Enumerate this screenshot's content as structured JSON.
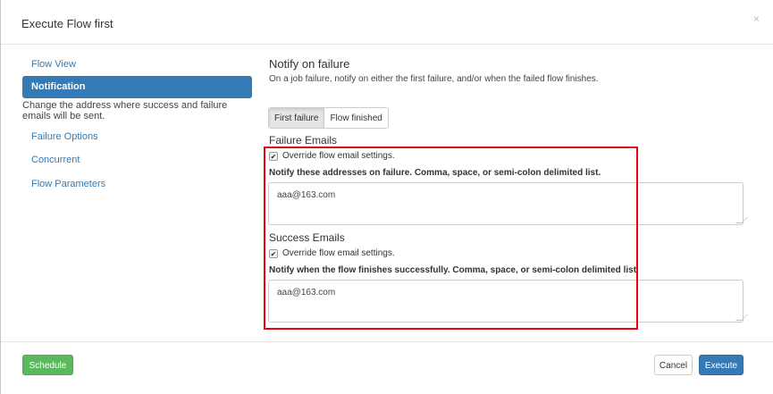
{
  "modal": {
    "title": "Execute Flow first",
    "close_glyph": "×"
  },
  "sidebar": {
    "items": [
      {
        "label": "Flow View"
      },
      {
        "label": "Notification"
      },
      {
        "label": "Failure Options"
      },
      {
        "label": "Concurrent"
      },
      {
        "label": "Flow Parameters"
      }
    ],
    "help_text": "Change the address where success and failure emails will be sent."
  },
  "main": {
    "title": "Notify on failure",
    "description": "On a job failure, notify on either the first failure, and/or when the failed flow finishes.",
    "toggle": {
      "first_failure": "First failure",
      "flow_finished": "Flow finished",
      "selected": "First failure"
    },
    "failure_emails": {
      "title": "Failure Emails",
      "override_label": "Override flow email settings.",
      "override_checked": true,
      "help": "Notify these addresses on failure. Comma, space, or semi-colon delimited list.",
      "value": "aaa@163.com"
    },
    "success_emails": {
      "title": "Success Emails",
      "override_label": "Override flow email settings.",
      "override_checked": true,
      "help": "Notify when the flow finishes successfully. Comma, space, or semi-colon delimited list.",
      "value": "aaa@163.com"
    }
  },
  "footer": {
    "schedule_label": "Schedule",
    "cancel_label": "Cancel",
    "execute_label": "Execute"
  },
  "colors": {
    "primary": "#337ab7",
    "success": "#5cb85c",
    "highlight": "#e60012"
  },
  "icons": {
    "checkbox_checked": "check-icon",
    "close": "close-icon"
  }
}
